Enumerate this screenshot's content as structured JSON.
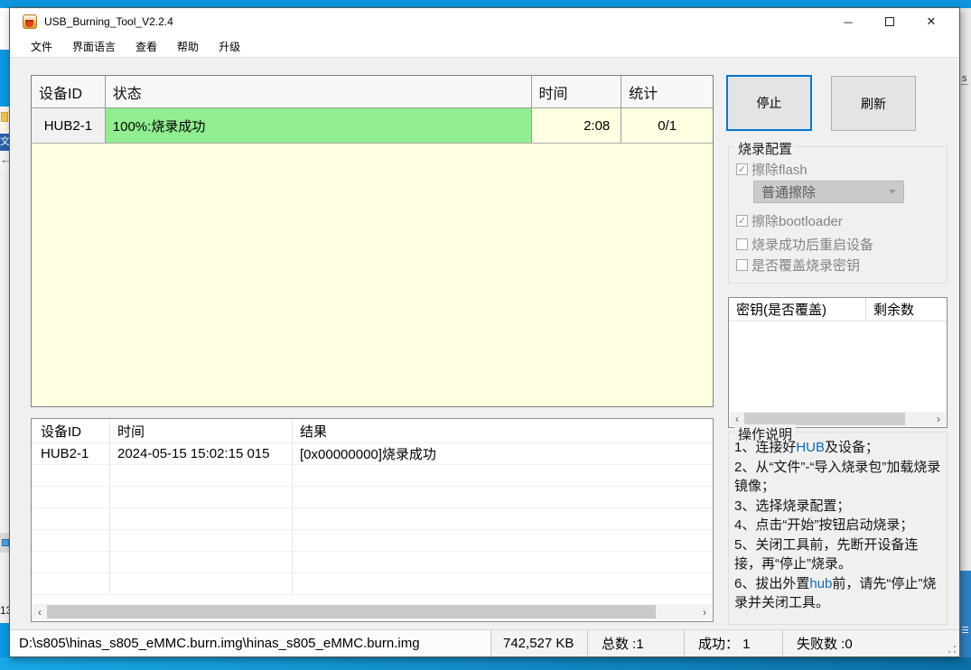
{
  "window": {
    "title": "USB_Burning_Tool_V2.2.4",
    "controls": {
      "minimize": "─",
      "close": "✕"
    }
  },
  "menu": {
    "items": [
      "文件",
      "界面语言",
      "查看",
      "帮助",
      "升级"
    ]
  },
  "device_table": {
    "headers": [
      "设备ID",
      "状态",
      "时间",
      "统计"
    ],
    "row": {
      "device_id": "HUB2-1",
      "status": "100%:烧录成功",
      "time": "2:08",
      "stats": "0/1"
    }
  },
  "actions": {
    "stop_label": "停止",
    "refresh_label": "刷新"
  },
  "burn_config": {
    "title": "烧录配置",
    "options": [
      {
        "label": "擦除flash",
        "mark": "✓"
      },
      {
        "label": "擦除bootloader",
        "mark": "✓"
      },
      {
        "label": "烧录成功后重启设备",
        "mark": ""
      },
      {
        "label": "是否覆盖烧录密钥",
        "mark": ""
      }
    ],
    "erase_mode": {
      "value": "普通擦除"
    }
  },
  "key_table": {
    "headers": [
      "密钥(是否覆盖)",
      "剩余数"
    ]
  },
  "instructions": {
    "title": "操作说明",
    "line1": {
      "pre": "1、连接好",
      "hub": "HUB",
      "post": "及设备；"
    },
    "line2": "2、从“文件”-“导入烧录包”加载烧录镜像；",
    "line3": "3、选择烧录配置；",
    "line4": "4、点击“开始”按钮启动烧录；",
    "line5": "5、关闭工具前，先断开设备连接，再“停止”烧录。",
    "line6": {
      "pre": "6、拔出外置",
      "hub": "hub",
      "post": "前，请先“停止”烧录并关闭工具。"
    }
  },
  "log_table": {
    "headers": [
      "设备ID",
      "时间",
      "结果"
    ],
    "row": {
      "device_id": "HUB2-1",
      "time": "2024-05-15 15:02:15 015",
      "result": "[0x00000000]烧录成功"
    }
  },
  "status_bar": {
    "file_path": "D:\\s805\\hinas_s805_eMMC.burn.img\\hinas_s805_eMMC.burn.img",
    "file_size": "742,527 KB",
    "total": "总数 :1",
    "success": "成功： 1",
    "failed": "失败数 :0"
  },
  "background": {
    "left_wen": "文",
    "left_arrow": "←",
    "left_number": "13",
    "right_text": "s"
  },
  "colors": {
    "accent_blue": "#0078D7",
    "success_green": "#90EE90",
    "pending_yellow": "#FFFFE1",
    "desktop_blue": "#0D95DE"
  }
}
